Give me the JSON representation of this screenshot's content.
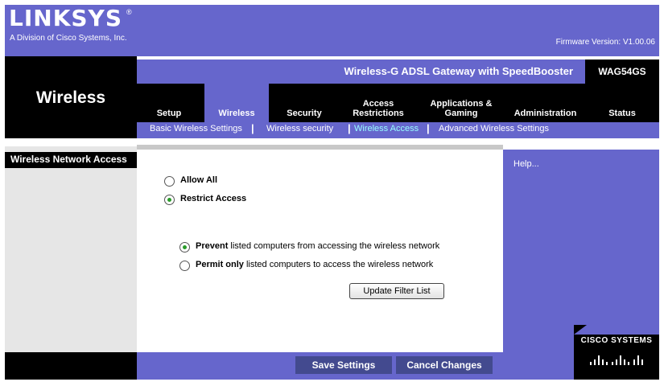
{
  "header": {
    "logo": "LINKSYS",
    "logo_reg": "®",
    "subtitle": "A Division of Cisco Systems, Inc.",
    "firmware": "Firmware Version: V1.00.06"
  },
  "section_title": "Wireless",
  "product": {
    "name": "Wireless-G ADSL Gateway with SpeedBooster",
    "model": "WAG54GS"
  },
  "tabs": [
    {
      "label": "Setup",
      "active": false
    },
    {
      "label": "Wireless",
      "active": true
    },
    {
      "label": "Security",
      "active": false
    },
    {
      "label": "Access Restrictions",
      "active": false
    },
    {
      "label": "Applications & Gaming",
      "active": false
    },
    {
      "label": "Administration",
      "active": false
    },
    {
      "label": "Status",
      "active": false
    }
  ],
  "subtabs": [
    {
      "label": "Basic Wireless Settings",
      "active": false
    },
    {
      "label": "Wireless security",
      "active": false
    },
    {
      "label": "Wireless Access",
      "active": true
    },
    {
      "label": "Advanced Wireless Settings",
      "active": false
    }
  ],
  "subtab_separator": "|",
  "left_panel": {
    "title": "Wireless Network Access"
  },
  "access_mode": {
    "selected": "restrict",
    "allow_all_label": "Allow All",
    "restrict_label": "Restrict Access"
  },
  "restrict_mode": {
    "selected": "prevent",
    "prevent_bold": "Prevent",
    "prevent_rest": " listed computers from accessing the wireless network",
    "permit_bold": "Permit only",
    "permit_rest": " listed computers to access the wireless network"
  },
  "update_filter_label": "Update Filter List",
  "help": {
    "link_label": "Help..."
  },
  "cisco": {
    "label": "CISCO SYSTEMS"
  },
  "footer": {
    "save_label": "Save Settings",
    "cancel_label": "Cancel Changes"
  },
  "colors": {
    "purple": "#6666cc",
    "black": "#000000",
    "grey": "#e6e6e6",
    "active_subtab": "#99ffff",
    "button": "#434a8f"
  }
}
